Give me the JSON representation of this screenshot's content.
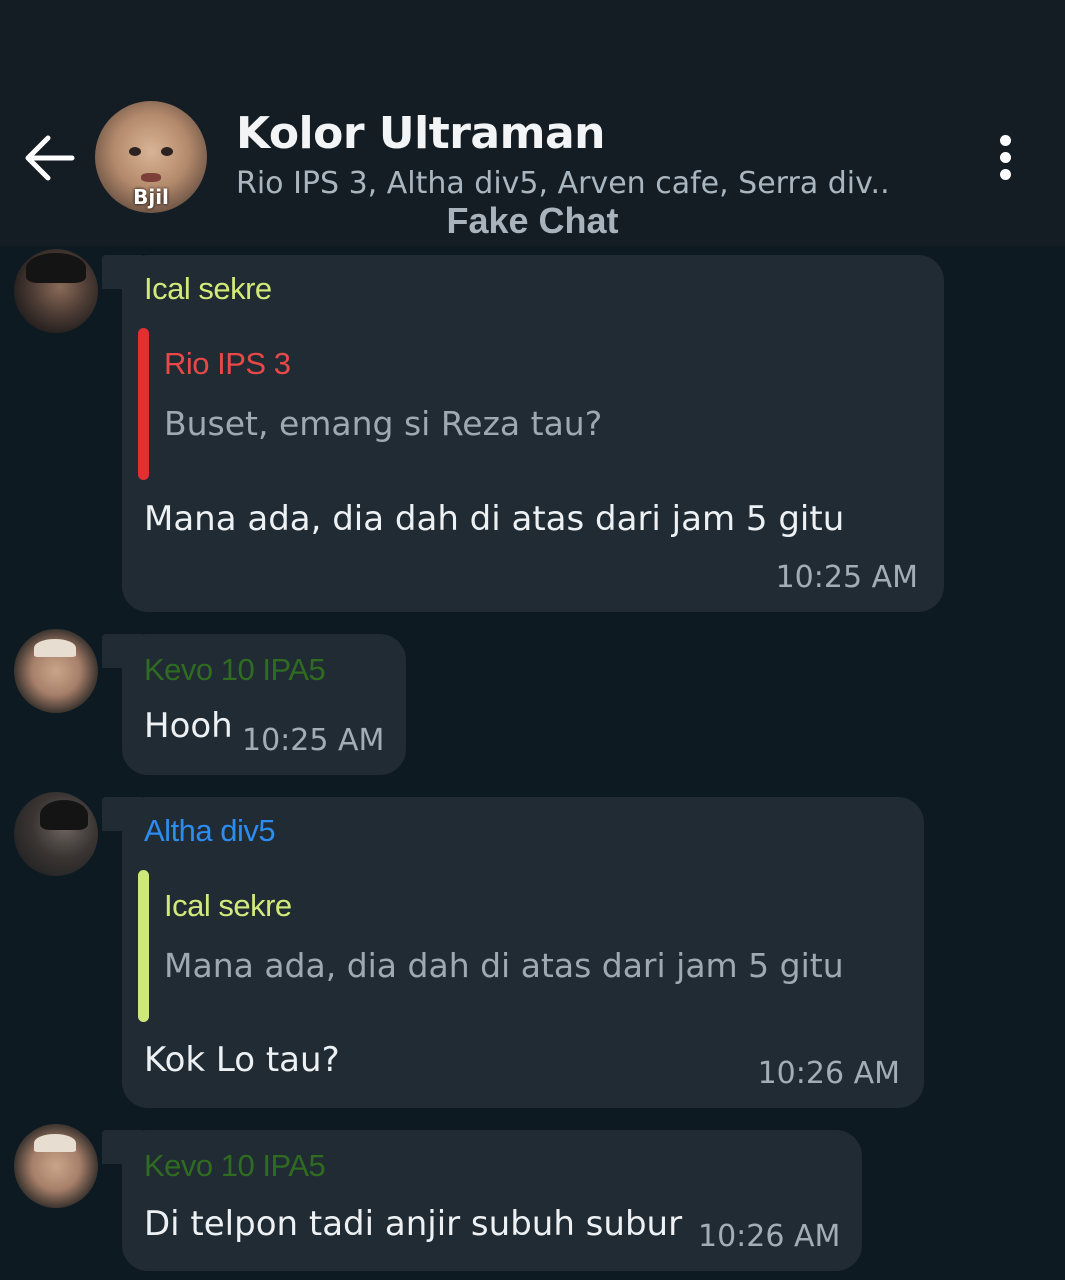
{
  "header": {
    "title": "Kolor Ultraman",
    "members": "Rio IPS 3, Altha div5, Arven cafe, Serra div..",
    "avatar_text": "Bjil",
    "watermark": "Fake Chat"
  },
  "colors": {
    "background": "#0e1a22",
    "header_bg": "#141d24",
    "bubble": "#202b33",
    "name_ical": "#d3ea7a",
    "name_rio": "#e84848",
    "name_altha": "#2d8cf0",
    "name_kevo": "#2f6b21",
    "reply_bar_rio": "#e03030",
    "reply_bar_ical": "#cfe87a"
  },
  "messages": [
    {
      "sender": "Ical sekre",
      "reply": {
        "name": "Rio IPS 3",
        "text": "Buset, emang si Reza tau?"
      },
      "text": "Mana ada, dia dah di atas dari jam 5 gitu",
      "time": "10:25 AM"
    },
    {
      "sender": "Kevo 10 IPA5",
      "text": "Hooh",
      "time": "10:25 AM"
    },
    {
      "sender": "Altha div5",
      "reply": {
        "name": "Ical sekre",
        "text": "Mana ada, dia dah di atas dari jam 5 gitu"
      },
      "text": "Kok Lo tau?",
      "time": "10:26 AM"
    },
    {
      "sender": "Kevo 10 IPA5",
      "text": "Di telpon tadi anjir subuh subur",
      "time": "10:26 AM"
    }
  ]
}
